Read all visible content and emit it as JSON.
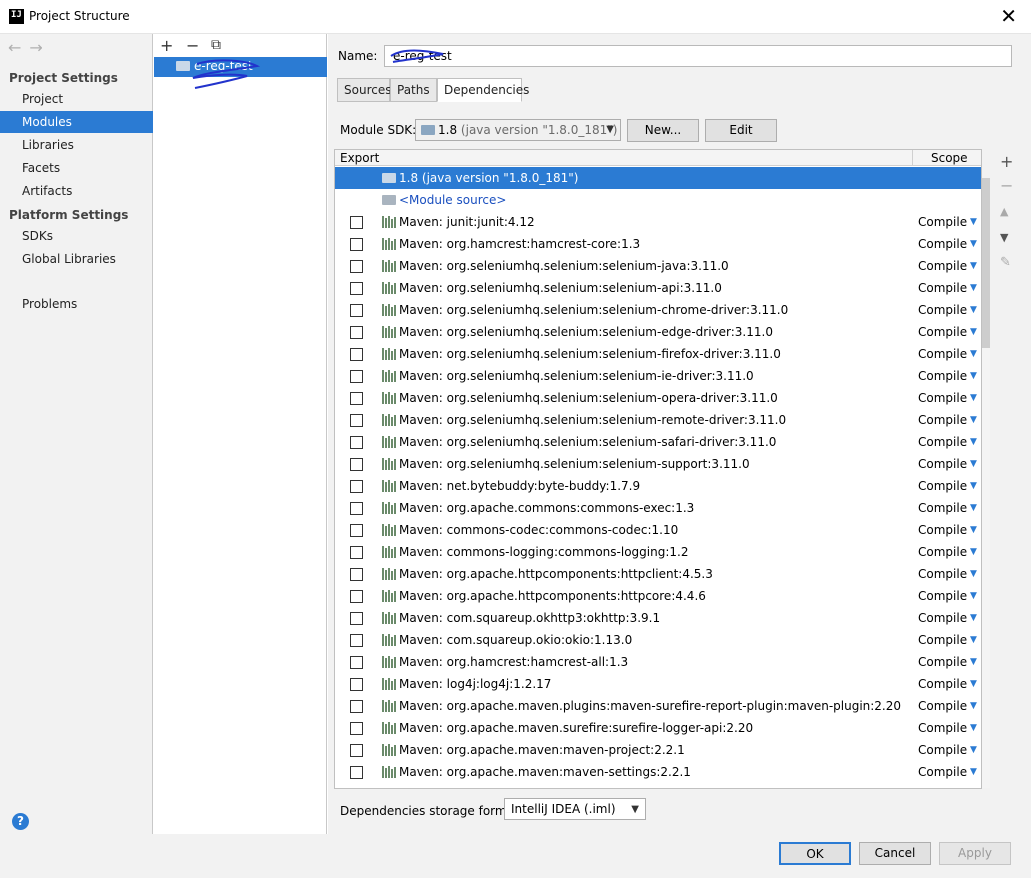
{
  "window": {
    "title": "Project Structure"
  },
  "nav": {
    "back": "←",
    "forward": "→",
    "project_settings": "Project Settings",
    "items_project": [
      "Project",
      "Modules",
      "Libraries",
      "Facets",
      "Artifacts"
    ],
    "platform_settings": "Platform Settings",
    "items_platform": [
      "SDKs",
      "Global Libraries"
    ],
    "problems": "Problems",
    "selected": "Modules",
    "help": "?"
  },
  "module_pane": {
    "add": "+",
    "remove": "−",
    "copy": "⧉",
    "module_name": "e-reg-test"
  },
  "editor": {
    "name_label": "Name:",
    "name_value": "e-reg-test",
    "tabs": [
      "Sources",
      "Paths",
      "Dependencies"
    ],
    "active_tab": "Dependencies",
    "sdk_label": "Module SDK:",
    "sdk_version": "1.8",
    "sdk_detail": "(java version \"1.8.0_181\")",
    "new_button": "New...",
    "edit_button": "Edit",
    "col_export": "Export",
    "col_scope": "Scope",
    "rows_top": [
      "1.8 (java version \"1.8.0_181\")",
      "<Module source>"
    ],
    "deps": [
      "Maven: junit:junit:4.12",
      "Maven: org.hamcrest:hamcrest-core:1.3",
      "Maven: org.seleniumhq.selenium:selenium-java:3.11.0",
      "Maven: org.seleniumhq.selenium:selenium-api:3.11.0",
      "Maven: org.seleniumhq.selenium:selenium-chrome-driver:3.11.0",
      "Maven: org.seleniumhq.selenium:selenium-edge-driver:3.11.0",
      "Maven: org.seleniumhq.selenium:selenium-firefox-driver:3.11.0",
      "Maven: org.seleniumhq.selenium:selenium-ie-driver:3.11.0",
      "Maven: org.seleniumhq.selenium:selenium-opera-driver:3.11.0",
      "Maven: org.seleniumhq.selenium:selenium-remote-driver:3.11.0",
      "Maven: org.seleniumhq.selenium:selenium-safari-driver:3.11.0",
      "Maven: org.seleniumhq.selenium:selenium-support:3.11.0",
      "Maven: net.bytebuddy:byte-buddy:1.7.9",
      "Maven: org.apache.commons:commons-exec:1.3",
      "Maven: commons-codec:commons-codec:1.10",
      "Maven: commons-logging:commons-logging:1.2",
      "Maven: org.apache.httpcomponents:httpclient:4.5.3",
      "Maven: org.apache.httpcomponents:httpcore:4.4.6",
      "Maven: com.squareup.okhttp3:okhttp:3.9.1",
      "Maven: com.squareup.okio:okio:1.13.0",
      "Maven: org.hamcrest:hamcrest-all:1.3",
      "Maven: log4j:log4j:1.2.17",
      "Maven: org.apache.maven.plugins:maven-surefire-report-plugin:maven-plugin:2.20",
      "Maven: org.apache.maven.surefire:surefire-logger-api:2.20",
      "Maven: org.apache.maven:maven-project:2.2.1",
      "Maven: org.apache.maven:maven-settings:2.2.1"
    ],
    "scope_value": "Compile",
    "side_tools": [
      "+",
      "−",
      "▲",
      "▼",
      "✎"
    ],
    "storage_label": "Dependencies storage format:",
    "storage_value": "IntelliJ IDEA (.iml)"
  },
  "footer": {
    "ok": "OK",
    "cancel": "Cancel",
    "apply": "Apply"
  },
  "colors": {
    "accent": "#2b7bd3",
    "panel": "#f2f2f2"
  }
}
